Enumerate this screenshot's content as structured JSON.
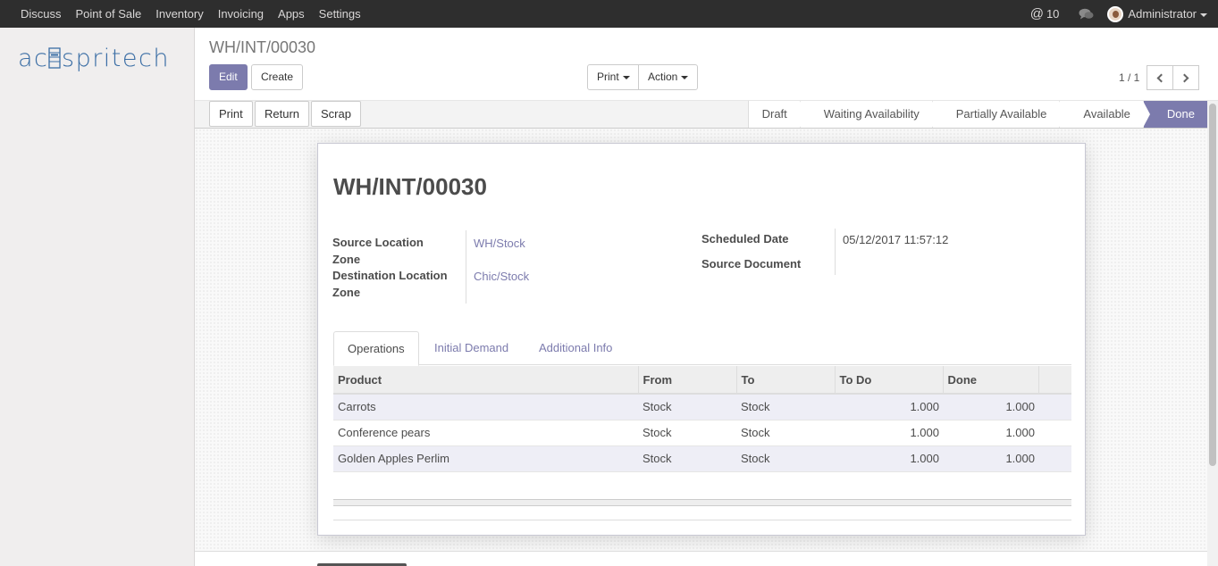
{
  "topbar": {
    "menu": [
      "Discuss",
      "Point of Sale",
      "Inventory",
      "Invoicing",
      "Apps",
      "Settings"
    ],
    "messages_count": "10",
    "user": "Administrator"
  },
  "logo_text": "acespritech",
  "breadcrumb": "WH/INT/00030",
  "buttons": {
    "edit": "Edit",
    "create": "Create",
    "print": "Print",
    "action": "Action"
  },
  "pager": "1 / 1",
  "header_buttons": {
    "print": "Print",
    "return": "Return",
    "scrap": "Scrap"
  },
  "status_stages": [
    "Draft",
    "Waiting Availability",
    "Partially Available",
    "Available",
    "Done"
  ],
  "active_stage": "Done",
  "record": {
    "title": "WH/INT/00030",
    "source_location_label": "Source Location Zone",
    "source_location": "WH/Stock",
    "destination_location_label": "Destination Location Zone",
    "destination_location": "Chic/Stock",
    "scheduled_date_label": "Scheduled Date",
    "scheduled_date": "05/12/2017 11:57:12",
    "source_document_label": "Source Document",
    "source_document": ""
  },
  "tabs": [
    "Operations",
    "Initial Demand",
    "Additional Info"
  ],
  "table": {
    "headers": [
      "Product",
      "From",
      "To",
      "To Do",
      "Done"
    ],
    "rows": [
      [
        "Carrots",
        "Stock",
        "Stock",
        "1.000",
        "1.000"
      ],
      [
        "Conference pears",
        "Stock",
        "Stock",
        "1.000",
        "1.000"
      ],
      [
        "Golden Apples Perlim",
        "Stock",
        "Stock",
        "1.000",
        "1.000"
      ]
    ]
  },
  "colors": {
    "brand": "#7c7bad",
    "navbar": "#2e2e2e"
  }
}
